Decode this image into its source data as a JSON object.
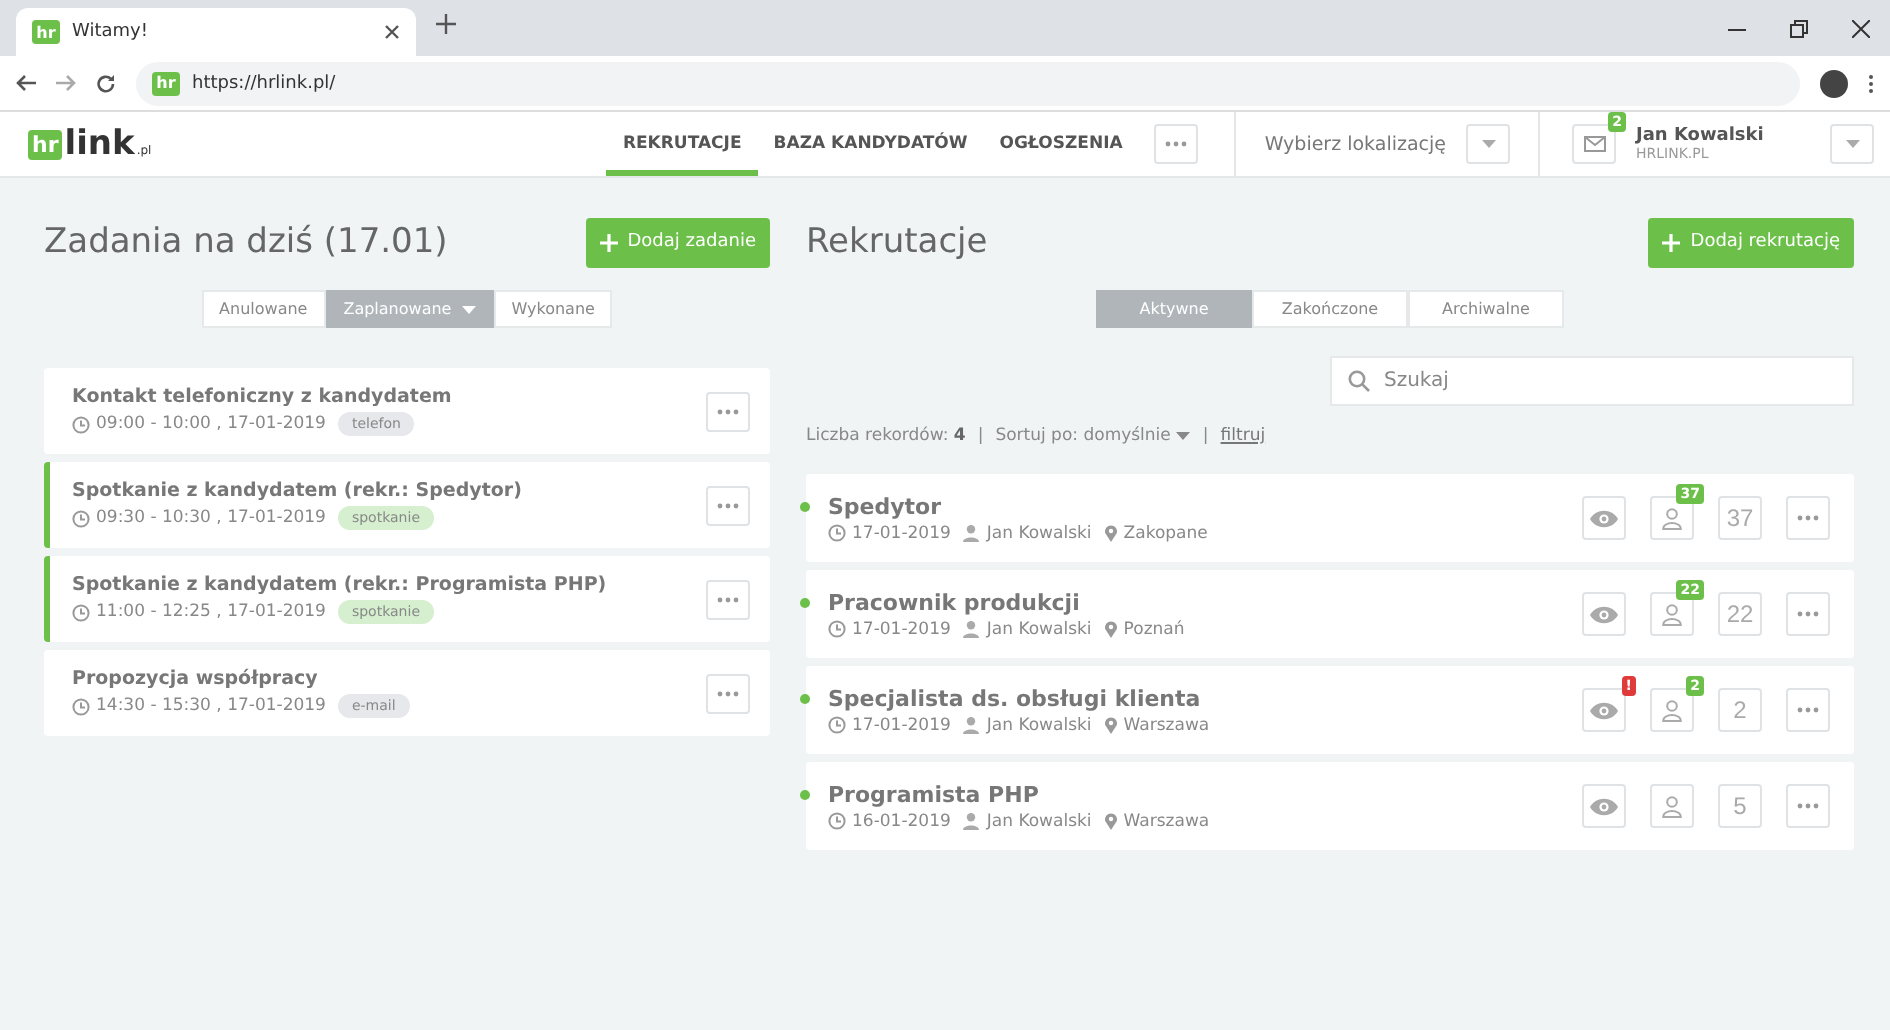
{
  "browser": {
    "tab_favicon": "hr",
    "tab_title": "Witamy!",
    "url_favicon": "hr",
    "url": "https://hrlink.pl/"
  },
  "header": {
    "logo": {
      "mark": "hr",
      "word": "link",
      "suffix": ".pl"
    },
    "nav": [
      {
        "label": "REKRUTACJE",
        "selected": true
      },
      {
        "label": "BAZA KANDYDATÓW",
        "selected": false
      },
      {
        "label": "OGŁOSZENIA",
        "selected": false
      }
    ],
    "location_placeholder": "Wybierz lokalizację",
    "mail_badge": "2",
    "user": {
      "name": "Jan Kowalski",
      "company": "HRLINK.PL"
    }
  },
  "tasks": {
    "title": "Zadania na dziś (17.01)",
    "add_button": "Dodaj zadanie",
    "filters": [
      {
        "label": "Anulowane",
        "selected": false
      },
      {
        "label": "Zaplanowane",
        "selected": true,
        "dropdown": true
      },
      {
        "label": "Wykonane",
        "selected": false
      }
    ],
    "items": [
      {
        "title": "Kontakt telefoniczny z kandydatem",
        "time": "09:00 - 10:00 , 17-01-2019",
        "tag": {
          "label": "telefon",
          "color": "#e6e8eb"
        },
        "highlighted": false
      },
      {
        "title": "Spotkanie z kandydatem (rekr.: Spedytor)",
        "time": "09:30 - 10:30 , 17-01-2019",
        "tag": {
          "label": "spotkanie",
          "color": "#d5efcf"
        },
        "highlighted": true
      },
      {
        "title": "Spotkanie z kandydatem (rekr.: Programista PHP)",
        "time": "11:00 - 12:25 , 17-01-2019",
        "tag": {
          "label": "spotkanie",
          "color": "#d5efcf"
        },
        "highlighted": true
      },
      {
        "title": "Propozycja współpracy",
        "time": "14:30 - 15:30 , 17-01-2019",
        "tag": {
          "label": "e-mail",
          "color": "#e6e8eb"
        },
        "highlighted": false
      }
    ]
  },
  "recruitments": {
    "title": "Rekrutacje",
    "add_button": "Dodaj rekrutację",
    "filters": [
      {
        "label": "Aktywne",
        "selected": true
      },
      {
        "label": "Zakończone",
        "selected": false
      },
      {
        "label": "Archiwalne",
        "selected": false
      }
    ],
    "search": {
      "placeholder": "Szukaj"
    },
    "count_label": "Liczba rekordów:",
    "count": "4",
    "separators": [
      "|",
      "|"
    ],
    "sort": "Sortuj po: domyślnie",
    "filter_link": "filtruj",
    "items": [
      {
        "title": "Spedytor",
        "date": "17-01-2019",
        "owner": "Jan Kowalski",
        "location": "Zakopane",
        "color": "#6cc04a",
        "new_candidates": "37",
        "candidates": "37"
      },
      {
        "title": "Pracownik produkcji",
        "date": "17-01-2019",
        "owner": "Jan Kowalski",
        "location": "Poznań",
        "color": "#6cc04a",
        "new_candidates": "22",
        "candidates": "22"
      },
      {
        "title": "Specjalista ds. obsługi klienta",
        "date": "17-01-2019",
        "owner": "Jan Kowalski",
        "location": "Warszawa",
        "color": "#6cc04a",
        "views_alert": "!",
        "new_candidates": "2",
        "candidates": "2"
      },
      {
        "title": "Programista PHP",
        "date": "16-01-2019",
        "owner": "Jan Kowalski",
        "location": "Warszawa",
        "color": "#6cc04a",
        "candidates": "5"
      }
    ]
  }
}
